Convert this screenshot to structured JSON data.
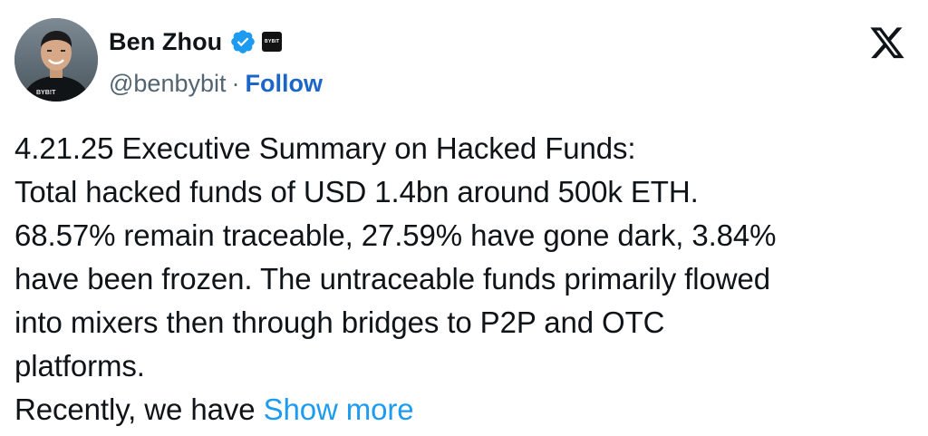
{
  "author": {
    "display_name": "Ben Zhou",
    "handle": "@benbybit",
    "separator": "·",
    "follow_label": "Follow",
    "verified_icon": "verified-badge-icon",
    "affiliate_badge_text": "BYBIT",
    "avatar_shirt_text": "BYB!T"
  },
  "platform": {
    "logo_icon": "x-logo-icon"
  },
  "tweet": {
    "lines": [
      "4.21.25 Executive Summary on Hacked Funds:",
      "Total hacked funds of USD 1.4bn around 500k ETH.",
      "68.57% remain traceable, 27.59% have gone dark, 3.84%",
      "have been frozen. The untraceable funds primarily flowed",
      "into mixers then through bridges to P2P and OTC",
      "platforms."
    ],
    "last_line_text": "Recently, we have ",
    "show_more_label": "Show more"
  },
  "colors": {
    "text": "#0f1419",
    "secondary": "#536471",
    "follow": "#1d66c9",
    "link": "#1d9bf0",
    "verified": "#1d9bf0"
  }
}
